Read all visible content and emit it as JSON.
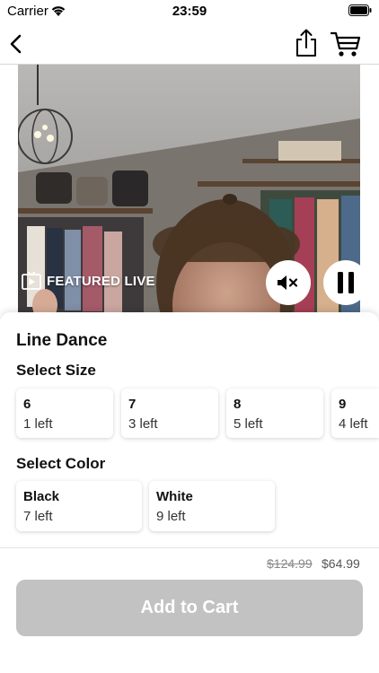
{
  "status_bar": {
    "carrier": "Carrier",
    "time": "23:59"
  },
  "nav": {
    "back_icon": "chevron-left-icon",
    "share_icon": "share-icon",
    "cart_icon": "cart-icon"
  },
  "video": {
    "badge_label": "FEATURED LIVE",
    "mute_icon": "speaker-muted-icon",
    "pause_icon": "pause-icon"
  },
  "product": {
    "title": "Line Dance",
    "size_section": "Select Size",
    "sizes": [
      {
        "name": "6",
        "stock": "1 left"
      },
      {
        "name": "7",
        "stock": "3 left"
      },
      {
        "name": "8",
        "stock": "5 left"
      },
      {
        "name": "9",
        "stock": "4 left"
      }
    ],
    "color_section": "Select Color",
    "colors": [
      {
        "name": "Black",
        "stock": "7 left"
      },
      {
        "name": "White",
        "stock": "9 left"
      }
    ],
    "original_price": "$124.99",
    "sale_price": "$64.99",
    "add_to_cart_label": "Add to Cart"
  },
  "colors": {
    "button_disabled": "#c2c2c2",
    "accent": "#000000"
  }
}
